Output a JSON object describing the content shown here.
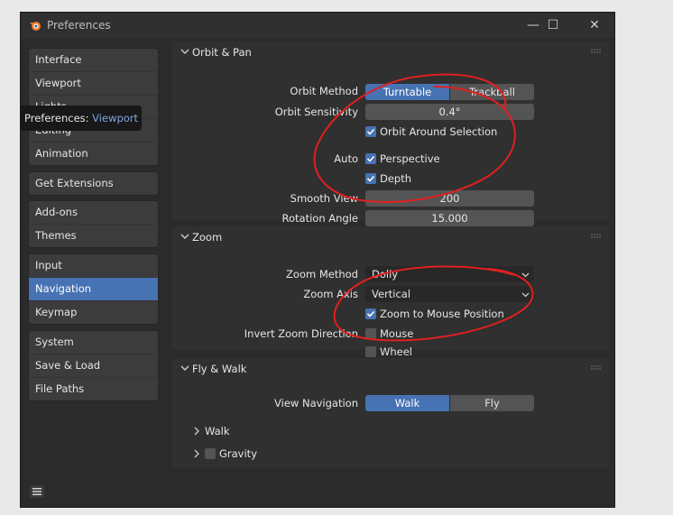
{
  "window": {
    "title": "Preferences",
    "controls": {
      "minimize": "—",
      "maximize": "☐",
      "close": "✕"
    }
  },
  "sidebar": {
    "groups": [
      {
        "items": [
          {
            "label": "Interface",
            "active": false
          },
          {
            "label": "Viewport",
            "active": false
          },
          {
            "label": "Lights",
            "active": false
          },
          {
            "label": "Editing",
            "active": false
          },
          {
            "label": "Animation",
            "active": false
          }
        ]
      },
      {
        "items": [
          {
            "label": "Get Extensions",
            "active": false
          }
        ]
      },
      {
        "items": [
          {
            "label": "Add-ons",
            "active": false
          },
          {
            "label": "Themes",
            "active": false
          }
        ]
      },
      {
        "items": [
          {
            "label": "Input",
            "active": false
          },
          {
            "label": "Navigation",
            "active": true
          },
          {
            "label": "Keymap",
            "active": false
          }
        ]
      },
      {
        "items": [
          {
            "label": "System",
            "active": false
          },
          {
            "label": "Save & Load",
            "active": false
          },
          {
            "label": "File Paths",
            "active": false
          }
        ]
      }
    ]
  },
  "tooltip": {
    "prefix": "Preferences:",
    "value": "Viewport"
  },
  "orbit_pan": {
    "title": "Orbit & Pan",
    "orbit_method": {
      "label": "Orbit Method",
      "options": [
        "Turntable",
        "Trackball"
      ],
      "selected": "Turntable"
    },
    "orbit_sensitivity": {
      "label": "Orbit Sensitivity",
      "value": "0.4°"
    },
    "orbit_around_selection": {
      "label": "Orbit Around Selection",
      "checked": true
    },
    "auto_label": "Auto",
    "perspective": {
      "label": "Perspective",
      "checked": true
    },
    "depth": {
      "label": "Depth",
      "checked": true
    },
    "smooth_view": {
      "label": "Smooth View",
      "value": "200"
    },
    "rotation_angle": {
      "label": "Rotation Angle",
      "value": "15.000"
    }
  },
  "zoom": {
    "title": "Zoom",
    "zoom_method": {
      "label": "Zoom Method",
      "value": "Dolly"
    },
    "zoom_axis": {
      "label": "Zoom Axis",
      "value": "Vertical"
    },
    "zoom_to_mouse": {
      "label": "Zoom to Mouse Position",
      "checked": true
    },
    "invert_label": "Invert Zoom Direction",
    "mouse": {
      "label": "Mouse",
      "checked": false
    },
    "wheel": {
      "label": "Wheel",
      "checked": false
    }
  },
  "fly_walk": {
    "title": "Fly & Walk",
    "view_navigation": {
      "label": "View Navigation",
      "options": [
        "Walk",
        "Fly"
      ],
      "selected": "Walk"
    },
    "walk_sub": "Walk",
    "gravity_sub": "Gravity",
    "gravity_checked": false
  },
  "colors": {
    "accent": "#4772b3",
    "annotation": "#e02020",
    "panel": "#303030",
    "window": "#2b2b2b"
  }
}
